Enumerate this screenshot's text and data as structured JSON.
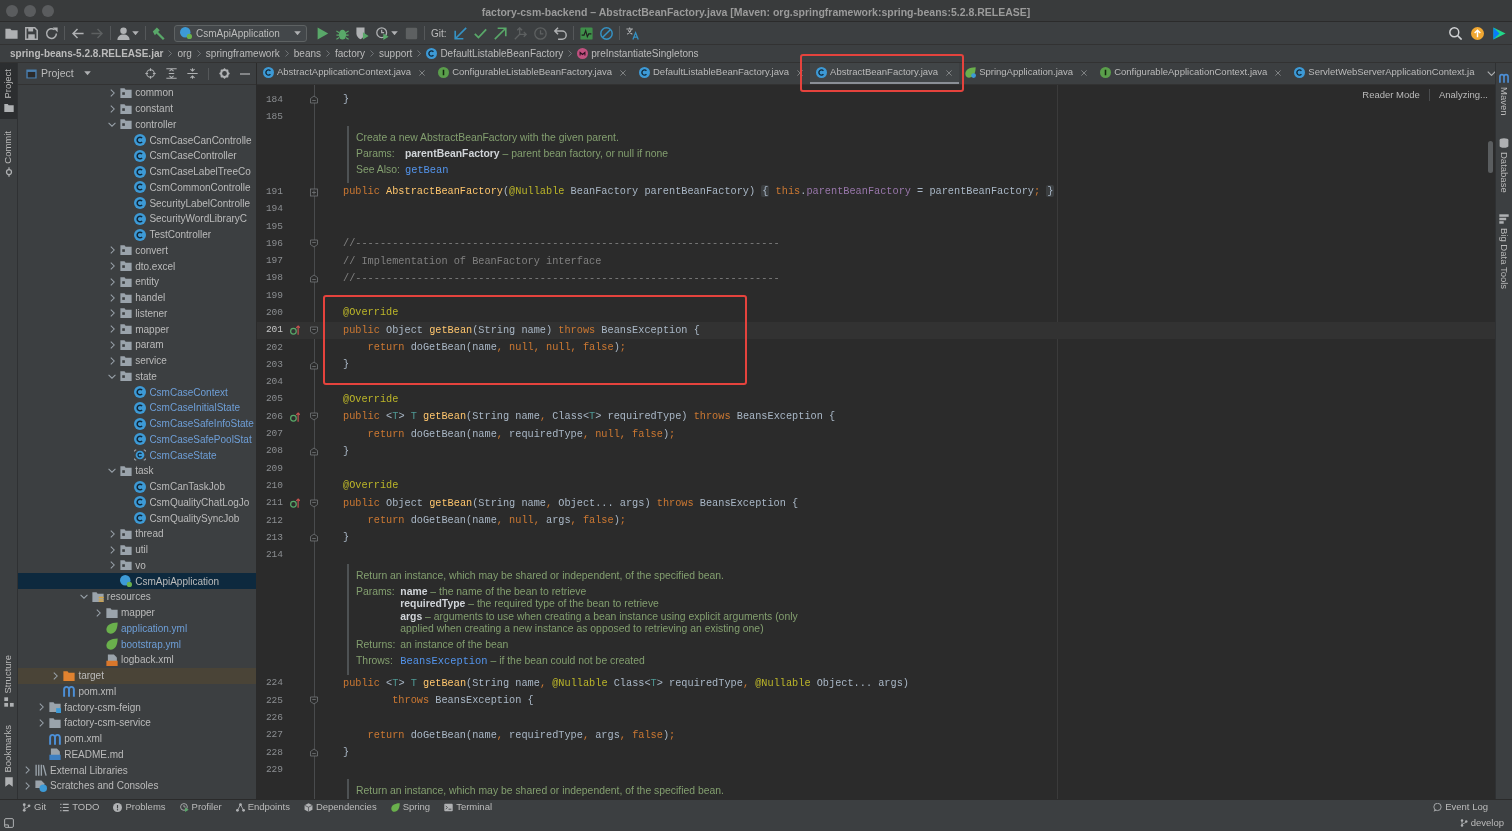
{
  "window": {
    "title": "factory-csm-backend – AbstractBeanFactory.java [Maven: org.springframework:spring-beans:5.2.8.RELEASE]"
  },
  "toolbar": {
    "groups": [
      [
        {
          "kind": "open",
          "disabled": false
        },
        {
          "kind": "save",
          "disabled": false
        },
        {
          "kind": "sync",
          "disabled": false
        }
      ],
      [
        {
          "kind": "back",
          "disabled": false
        },
        {
          "kind": "forward",
          "disabled": true
        }
      ],
      [
        {
          "kind": "person",
          "disabled": false
        }
      ],
      [
        {
          "kind": "build",
          "disabled": false
        },
        {
          "kind": "run-config",
          "label": "CsmApiApplication"
        },
        {
          "kind": "run",
          "disabled": false
        },
        {
          "kind": "debug",
          "disabled": false
        },
        {
          "kind": "coverage",
          "disabled": false
        },
        {
          "kind": "profile",
          "disabled": false
        },
        {
          "kind": "stop",
          "disabled": true
        }
      ],
      [
        {
          "kind": "label",
          "text": "Git:"
        },
        {
          "kind": "vcs-update",
          "disabled": false
        },
        {
          "kind": "vcs-commit",
          "disabled": false
        },
        {
          "kind": "vcs-push",
          "disabled": false
        },
        {
          "kind": "vcs-compare",
          "disabled": true
        },
        {
          "kind": "history",
          "disabled": true
        },
        {
          "kind": "rollback",
          "disabled": false
        }
      ],
      [
        {
          "kind": "monitor",
          "disabled": false
        },
        {
          "kind": "block",
          "disabled": false
        }
      ],
      [
        {
          "kind": "translate",
          "disabled": false
        }
      ]
    ],
    "right": [
      {
        "kind": "search",
        "disabled": false
      },
      {
        "kind": "update",
        "disabled": false
      },
      {
        "kind": "toolbox",
        "disabled": false
      }
    ]
  },
  "breadcrumb": [
    {
      "kind": "jar",
      "label": "spring-beans-5.2.8.RELEASE.jar"
    },
    {
      "kind": "package",
      "label": "org"
    },
    {
      "kind": "package",
      "label": "springframework"
    },
    {
      "kind": "package",
      "label": "beans"
    },
    {
      "kind": "package",
      "label": "factory"
    },
    {
      "kind": "package",
      "label": "support"
    },
    {
      "kind": "class",
      "label": "DefaultListableBeanFactory"
    },
    {
      "kind": "method",
      "label": "preInstantiateSingletons"
    }
  ],
  "left_stripe": {
    "top": [
      {
        "kind": "project",
        "label": "Project",
        "selected": true
      },
      {
        "kind": "commit",
        "label": "Commit",
        "selected": false
      }
    ],
    "bottom": [
      {
        "kind": "structure",
        "label": "Structure",
        "selected": false
      },
      {
        "kind": "bookmarks",
        "label": "Bookmarks",
        "selected": false
      }
    ]
  },
  "project_panel": {
    "title": "Project",
    "tree": [
      {
        "children": [
          {
            "children": [
              {
                "children": [
                  {
                    "children": [
                      {
                        "children": [
                          {
                            "children": [
                              {
                                "label": "common",
                                "kind": "package",
                                "expanded": false,
                                "modified": false,
                                "selected": false
                              },
                              {
                                "label": "constant",
                                "kind": "package",
                                "expanded": false,
                                "modified": false,
                                "selected": false
                              },
                              {
                                "label": "controller",
                                "kind": "package",
                                "expanded": true,
                                "modified": false,
                                "selected": false,
                                "children": [
                                  {
                                    "label": "CsmCaseCanControlle",
                                    "kind": "class",
                                    "modified": false,
                                    "selected": false
                                  },
                                  {
                                    "label": "CsmCaseController",
                                    "kind": "class",
                                    "modified": false,
                                    "selected": false
                                  },
                                  {
                                    "label": "CsmCaseLabelTreeCo",
                                    "kind": "class",
                                    "modified": false,
                                    "selected": false
                                  },
                                  {
                                    "label": "CsmCommonControlle",
                                    "kind": "class",
                                    "modified": false,
                                    "selected": false
                                  },
                                  {
                                    "label": "SecurityLabelControlle",
                                    "kind": "class",
                                    "modified": false,
                                    "selected": false
                                  },
                                  {
                                    "label": "SecurityWordLibraryC",
                                    "kind": "class",
                                    "modified": false,
                                    "selected": false
                                  },
                                  {
                                    "label": "TestController",
                                    "kind": "class",
                                    "modified": false,
                                    "selected": false
                                  }
                                ]
                              },
                              {
                                "label": "convert",
                                "kind": "package",
                                "expanded": false,
                                "modified": false,
                                "selected": false
                              },
                              {
                                "label": "dto.excel",
                                "kind": "package",
                                "expanded": false,
                                "modified": false,
                                "selected": false
                              },
                              {
                                "label": "entity",
                                "kind": "package",
                                "expanded": false,
                                "modified": false,
                                "selected": false
                              },
                              {
                                "label": "handel",
                                "kind": "package",
                                "expanded": false,
                                "modified": false,
                                "selected": false
                              },
                              {
                                "label": "listener",
                                "kind": "package",
                                "expanded": false,
                                "modified": false,
                                "selected": false
                              },
                              {
                                "label": "mapper",
                                "kind": "package",
                                "expanded": false,
                                "modified": false,
                                "selected": false
                              },
                              {
                                "label": "param",
                                "kind": "package",
                                "expanded": false,
                                "modified": false,
                                "selected": false
                              },
                              {
                                "label": "service",
                                "kind": "package",
                                "expanded": false,
                                "modified": false,
                                "selected": false
                              },
                              {
                                "label": "state",
                                "kind": "package",
                                "expanded": true,
                                "modified": false,
                                "selected": false,
                                "children": [
                                  {
                                    "label": "CsmCaseContext",
                                    "kind": "class",
                                    "modified": true,
                                    "selected": false
                                  },
                                  {
                                    "label": "CsmCaseInitialState",
                                    "kind": "class",
                                    "modified": true,
                                    "selected": false
                                  },
                                  {
                                    "label": "CsmCaseSafeInfoState",
                                    "kind": "class",
                                    "modified": true,
                                    "selected": false
                                  },
                                  {
                                    "label": "CsmCaseSafePoolStat",
                                    "kind": "class",
                                    "modified": true,
                                    "selected": false
                                  },
                                  {
                                    "label": "CsmCaseState",
                                    "kind": "abstract",
                                    "modified": true,
                                    "selected": false
                                  }
                                ]
                              },
                              {
                                "label": "task",
                                "kind": "package",
                                "expanded": true,
                                "modified": false,
                                "selected": false,
                                "children": [
                                  {
                                    "label": "CsmCanTaskJob",
                                    "kind": "class",
                                    "modified": false,
                                    "selected": false
                                  },
                                  {
                                    "label": "CsmQualityChatLogJo",
                                    "kind": "class",
                                    "modified": false,
                                    "selected": false
                                  },
                                  {
                                    "label": "CsmQualitySyncJob",
                                    "kind": "class",
                                    "modified": false,
                                    "selected": false
                                  }
                                ]
                              },
                              {
                                "label": "thread",
                                "kind": "package",
                                "expanded": false,
                                "modified": false,
                                "selected": false
                              },
                              {
                                "label": "util",
                                "kind": "package",
                                "expanded": false,
                                "modified": false,
                                "selected": false
                              },
                              {
                                "label": "vo",
                                "kind": "package",
                                "expanded": false,
                                "modified": false,
                                "selected": false
                              },
                              {
                                "label": "CsmApiApplication",
                                "kind": "spring-app",
                                "modified": false,
                                "selected": true
                              }
                            ]
                          }
                        ]
                      },
                      {
                        "label": "resources",
                        "kind": "resources",
                        "expanded": true,
                        "modified": false,
                        "selected": false,
                        "children": [
                          {
                            "label": "mapper",
                            "kind": "folder",
                            "expanded": false,
                            "modified": false,
                            "selected": false
                          },
                          {
                            "label": "application.yml",
                            "kind": "spring-config",
                            "modified": true,
                            "selected": false
                          },
                          {
                            "label": "bootstrap.yml",
                            "kind": "spring-config",
                            "modified": true,
                            "selected": false
                          },
                          {
                            "label": "logback.xml",
                            "kind": "xml",
                            "modified": false,
                            "selected": false
                          }
                        ]
                      }
                    ]
                  }
                ]
              },
              {
                "label": "target",
                "kind": "excluded",
                "expanded": false,
                "modified": false,
                "selected": false
              },
              {
                "label": "pom.xml",
                "kind": "maven",
                "modified": false,
                "selected": false
              }
            ]
          },
          {
            "label": "factory-csm-feign",
            "kind": "module",
            "expanded": false,
            "modified": false,
            "selected": false
          },
          {
            "label": "factory-csm-service",
            "kind": "folder",
            "expanded": false,
            "modified": false,
            "selected": false
          },
          {
            "label": "pom.xml",
            "kind": "maven",
            "modified": false,
            "selected": false
          },
          {
            "label": "README.md",
            "kind": "markdown",
            "modified": false,
            "selected": false
          }
        ]
      },
      {
        "label": "External Libraries",
        "kind": "libraries",
        "expanded": false,
        "modified": false,
        "selected": false
      },
      {
        "label": "Scratches and Consoles",
        "kind": "scratches",
        "expanded": false,
        "modified": false,
        "selected": false
      }
    ]
  },
  "tabs": [
    {
      "label": "AbstractApplicationContext.java",
      "kind": "class",
      "selected": false,
      "framed": false,
      "closable": true
    },
    {
      "label": "ConfigurableListableBeanFactory.java",
      "kind": "interface",
      "selected": false,
      "framed": false,
      "closable": true
    },
    {
      "label": "DefaultListableBeanFactory.java",
      "kind": "class",
      "selected": false,
      "framed": false,
      "closable": true
    },
    {
      "label": "AbstractBeanFactory.java",
      "kind": "class",
      "selected": true,
      "framed": true,
      "closable": true
    },
    {
      "label": "SpringApplication.java",
      "kind": "spring",
      "selected": false,
      "framed": false,
      "closable": true
    },
    {
      "label": "ConfigurableApplicationContext.java",
      "kind": "interface",
      "selected": false,
      "framed": false,
      "closable": true
    },
    {
      "label": "ServletWebServerApplicationContext.ja",
      "kind": "class",
      "selected": false,
      "framed": false,
      "closable": false
    }
  ],
  "editor": {
    "reader_mode": "Reader Mode",
    "status": "Analyzing...",
    "lines": [
      {
        "kind": "code",
        "number": "184",
        "current": false,
        "fold_marker": {
          "kind": "end"
        },
        "tokens": [
          {
            "text": "}"
          }
        ]
      },
      {
        "kind": "code",
        "number": "185",
        "current": false
      },
      {
        "kind": "doc",
        "summary": "Create a new AbstractBeanFactory with the given parent.",
        "sections": [
          {
            "label": "Params:",
            "entries": [
              {
                "text": "**parentBeanFactory** – parent bean factory, or null if none"
              }
            ]
          },
          {
            "label": "See Also:",
            "entries": [
              {
                "link": "getBean"
              }
            ]
          }
        ]
      },
      {
        "kind": "code",
        "number": "191",
        "current": false,
        "fold_marker": {
          "kind": "folded"
        },
        "tokens": [
          {
            "kind": "keyword",
            "text": "public "
          },
          {
            "kind": "method",
            "text": "AbstractBeanFactory"
          },
          {
            "text": "("
          },
          {
            "kind": "annotation",
            "text": "@Nullable"
          },
          {
            "text": " BeanFactory parentBeanFactory) "
          },
          {
            "kind": "brace",
            "text": "{"
          },
          {
            "kind": "keyword",
            "text": " this"
          },
          {
            "text": "."
          },
          {
            "kind": "field",
            "text": "parentBeanFactory"
          },
          {
            "text": " = parentBeanFactory"
          },
          {
            "kind": "keyword",
            "text": "; "
          },
          {
            "kind": "brace",
            "text": "}"
          }
        ]
      },
      {
        "kind": "code",
        "number": "194",
        "current": false
      },
      {
        "kind": "code",
        "number": "195",
        "current": false
      },
      {
        "kind": "code",
        "number": "196",
        "current": false,
        "fold_marker": {
          "kind": "start"
        },
        "tokens": [
          {
            "kind": "comment",
            "text": "//---------------------------------------------------------------------"
          }
        ]
      },
      {
        "kind": "code",
        "number": "197",
        "current": false,
        "tokens": [
          {
            "kind": "comment",
            "text": "// Implementation of BeanFactory interface"
          }
        ]
      },
      {
        "kind": "code",
        "number": "198",
        "current": false,
        "fold_marker": {
          "kind": "end"
        },
        "tokens": [
          {
            "kind": "comment",
            "text": "//---------------------------------------------------------------------"
          }
        ]
      },
      {
        "kind": "code",
        "number": "199",
        "current": false
      },
      {
        "kind": "framed",
        "lines": [
          {
            "kind": "code",
            "number": "200",
            "current": false,
            "tokens": [
              {
                "kind": "annotation",
                "text": "@Override"
              }
            ]
          },
          {
            "kind": "code",
            "number": "201",
            "current": true,
            "gutter_icon": {
              "kind": "override"
            },
            "fold_marker": {
              "kind": "start"
            },
            "tokens": [
              {
                "kind": "keyword",
                "text": "public"
              },
              {
                "text": " Object "
              },
              {
                "kind": "method",
                "text": "getBean"
              },
              {
                "text": "(String name) "
              },
              {
                "kind": "keyword",
                "text": "throws"
              },
              {
                "text": " BeansException {"
              }
            ]
          },
          {
            "kind": "code",
            "number": "202",
            "current": false,
            "tokens": [
              {
                "kind": "keyword",
                "text": "    return"
              },
              {
                "text": " doGetBean(name"
              },
              {
                "kind": "keyword",
                "text": ", null, null, false"
              },
              {
                "text": ")"
              },
              {
                "kind": "keyword",
                "text": ";"
              }
            ]
          },
          {
            "kind": "code",
            "number": "203",
            "current": false,
            "fold_marker": {
              "kind": "end"
            },
            "tokens": [
              {
                "text": "}"
              }
            ]
          }
        ]
      },
      {
        "kind": "code",
        "number": "204",
        "current": false
      },
      {
        "kind": "code",
        "number": "205",
        "current": false,
        "tokens": [
          {
            "kind": "annotation",
            "text": "@Override"
          }
        ]
      },
      {
        "kind": "code",
        "number": "206",
        "current": false,
        "gutter_icon": {
          "kind": "override"
        },
        "fold_marker": {
          "kind": "start"
        },
        "tokens": [
          {
            "kind": "keyword",
            "text": "public"
          },
          {
            "text": " <"
          },
          {
            "kind": "typeparam",
            "text": "T"
          },
          {
            "text": "> "
          },
          {
            "kind": "typeparam",
            "text": "T"
          },
          {
            "kind": "method",
            "text": " getBean"
          },
          {
            "text": "(String name"
          },
          {
            "kind": "keyword",
            "text": ","
          },
          {
            "text": " Class<"
          },
          {
            "kind": "typeparam",
            "text": "T"
          },
          {
            "text": "> requiredType) "
          },
          {
            "kind": "keyword",
            "text": "throws"
          },
          {
            "text": " BeansException {"
          }
        ]
      },
      {
        "kind": "code",
        "number": "207",
        "current": false,
        "tokens": [
          {
            "kind": "keyword",
            "text": "    return"
          },
          {
            "text": " doGetBean(name"
          },
          {
            "kind": "keyword",
            "text": ","
          },
          {
            "text": " requiredType"
          },
          {
            "kind": "keyword",
            "text": ", null, false"
          },
          {
            "text": ")"
          },
          {
            "kind": "keyword",
            "text": ";"
          }
        ]
      },
      {
        "kind": "code",
        "number": "208",
        "current": false,
        "fold_marker": {
          "kind": "end"
        },
        "tokens": [
          {
            "text": "}"
          }
        ]
      },
      {
        "kind": "code",
        "number": "209",
        "current": false
      },
      {
        "kind": "code",
        "number": "210",
        "current": false,
        "tokens": [
          {
            "kind": "annotation",
            "text": "@Override"
          }
        ]
      },
      {
        "kind": "code",
        "number": "211",
        "current": false,
        "gutter_icon": {
          "kind": "override"
        },
        "fold_marker": {
          "kind": "start"
        },
        "tokens": [
          {
            "kind": "keyword",
            "text": "public"
          },
          {
            "text": " Object "
          },
          {
            "kind": "method",
            "text": "getBean"
          },
          {
            "text": "(String name"
          },
          {
            "kind": "keyword",
            "text": ","
          },
          {
            "text": " Object... args) "
          },
          {
            "kind": "keyword",
            "text": "throws"
          },
          {
            "text": " BeansException {"
          }
        ]
      },
      {
        "kind": "code",
        "number": "212",
        "current": false,
        "tokens": [
          {
            "kind": "keyword",
            "text": "    return"
          },
          {
            "text": " doGetBean(name"
          },
          {
            "kind": "keyword",
            "text": ", null,"
          },
          {
            "text": " args"
          },
          {
            "kind": "keyword",
            "text": ", false"
          },
          {
            "text": ")"
          },
          {
            "kind": "keyword",
            "text": ";"
          }
        ]
      },
      {
        "kind": "code",
        "number": "213",
        "current": false,
        "fold_marker": {
          "kind": "end"
        },
        "tokens": [
          {
            "text": "}"
          }
        ]
      },
      {
        "kind": "code",
        "number": "214",
        "current": false
      },
      {
        "kind": "doc",
        "summary": "Return an instance, which may be shared or independent, of the specified bean.",
        "sections": [
          {
            "label": "Params:",
            "entries": [
              {
                "text": "**name** – the name of the bean to retrieve"
              },
              {
                "text": "**requiredType** – the required type of the bean to retrieve"
              },
              {
                "text": "**args** – arguments to use when creating a bean instance using explicit arguments (only applied when creating a new instance as opposed to retrieving an existing one)"
              }
            ]
          },
          {
            "label": "Returns:",
            "entries": [
              {
                "text": "an instance of the bean"
              }
            ]
          },
          {
            "label": "Throws:",
            "entries": [
              {
                "link": "BeansException",
                "text": "– if the bean could not be created"
              }
            ]
          }
        ]
      },
      {
        "kind": "code",
        "number": "224",
        "current": false,
        "tokens": [
          {
            "kind": "keyword",
            "text": "public"
          },
          {
            "text": " <"
          },
          {
            "kind": "typeparam",
            "text": "T"
          },
          {
            "text": "> "
          },
          {
            "kind": "typeparam",
            "text": "T"
          },
          {
            "kind": "method",
            "text": " getBean"
          },
          {
            "text": "(String name"
          },
          {
            "kind": "keyword",
            "text": ","
          },
          {
            "kind": "annotation",
            "text": " @Nullable"
          },
          {
            "text": " Class<"
          },
          {
            "kind": "typeparam",
            "text": "T"
          },
          {
            "text": "> requiredType"
          },
          {
            "kind": "keyword",
            "text": ","
          },
          {
            "kind": "annotation",
            "text": " @Nullable"
          },
          {
            "text": " Object... args)"
          }
        ]
      },
      {
        "kind": "code",
        "number": "225",
        "current": false,
        "fold_marker": {
          "kind": "start"
        },
        "tokens": [
          {
            "kind": "keyword",
            "text": "        throws"
          },
          {
            "text": " BeansException {"
          }
        ]
      },
      {
        "kind": "code",
        "number": "226",
        "current": false
      },
      {
        "kind": "code",
        "number": "227",
        "current": false,
        "tokens": [
          {
            "kind": "keyword",
            "text": "    return"
          },
          {
            "text": " doGetBean(name"
          },
          {
            "kind": "keyword",
            "text": ","
          },
          {
            "text": " requiredType"
          },
          {
            "kind": "keyword",
            "text": ","
          },
          {
            "text": " args"
          },
          {
            "kind": "keyword",
            "text": ", false"
          },
          {
            "text": ")"
          },
          {
            "kind": "keyword",
            "text": ";"
          }
        ]
      },
      {
        "kind": "code",
        "number": "228",
        "current": false,
        "fold_marker": {
          "kind": "end"
        },
        "tokens": [
          {
            "text": "}"
          }
        ]
      },
      {
        "kind": "code",
        "number": "229",
        "current": false
      },
      {
        "kind": "doc",
        "summary": "Return an instance, which may be shared or independent, of the specified bean."
      }
    ]
  },
  "right_stripe": [
    {
      "kind": "maven",
      "label": "Maven",
      "selected": false
    },
    {
      "kind": "database",
      "label": "Database",
      "selected": false
    },
    {
      "kind": "bigdata",
      "label": "Big Data Tools",
      "selected": false
    }
  ],
  "tool_window_bar": {
    "left": [
      {
        "kind": "git",
        "label": "Git"
      },
      {
        "kind": "todo",
        "label": "TODO"
      },
      {
        "kind": "problems",
        "label": "Problems"
      },
      {
        "kind": "profiler",
        "label": "Profiler"
      },
      {
        "kind": "endpoints",
        "label": "Endpoints"
      },
      {
        "kind": "dependencies",
        "label": "Dependencies"
      },
      {
        "kind": "spring",
        "label": "Spring"
      },
      {
        "kind": "terminal",
        "label": "Terminal"
      }
    ],
    "right": [
      {
        "kind": "event-log",
        "label": "Event Log"
      }
    ]
  },
  "status_bar": {
    "branch": "develop"
  }
}
